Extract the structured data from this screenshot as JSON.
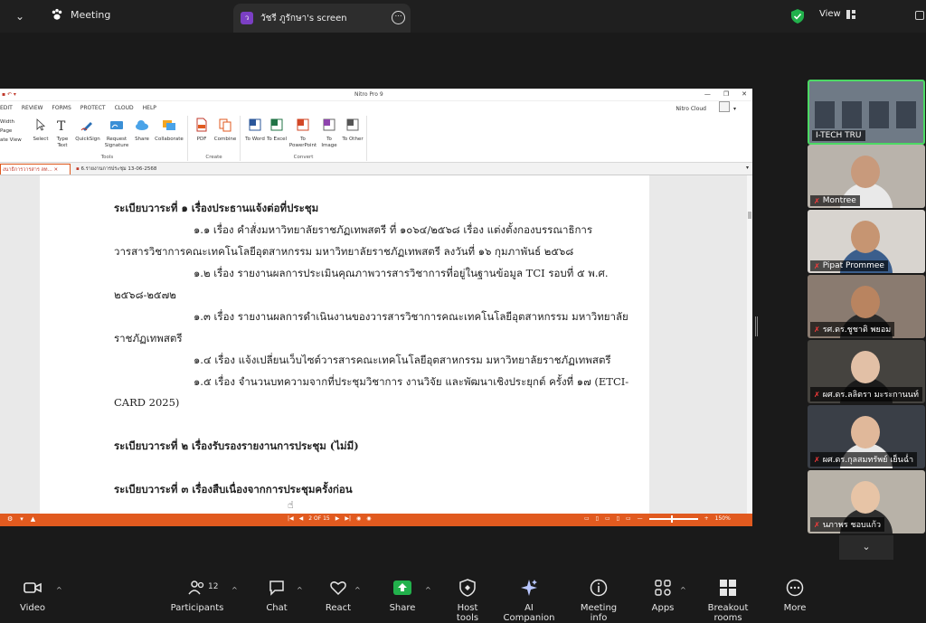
{
  "topbar": {
    "meeting_label": "Meeting",
    "share_tab_title": "วัชรี ภูรักษา's screen",
    "share_tab_avatar": "ว",
    "view_label": "View"
  },
  "nitro": {
    "app_title": "Nitro Pro 9",
    "menu": [
      "EDIT",
      "REVIEW",
      "FORMS",
      "PROTECT",
      "CLOUD",
      "HELP"
    ],
    "cloud_label": "Nitro Cloud",
    "left_tools": [
      "Width",
      "Page",
      "ate View"
    ],
    "tools_group": {
      "label": "Tools",
      "buttons": [
        "Select",
        "Type Text",
        "QuickSign",
        "Request Signature",
        "Share",
        "Collaborate"
      ]
    },
    "create_group": {
      "label": "Create",
      "buttons": [
        "PDF",
        "Combine"
      ]
    },
    "convert_group": {
      "label": "Convert",
      "buttons": [
        "To Word",
        "To Excel",
        "To PowerPoint",
        "To Image",
        "To Other"
      ]
    },
    "doc_tabs": [
      "งนาธิการวารสาร ลท...",
      "6.รายงานการประชุม 13-06-2568"
    ],
    "document_lines": [
      {
        "text": "ระเบียบวาระที่ ๑  เรื่องประธานแจ้งต่อที่ประชุม",
        "bold": true
      },
      {
        "text": "๑.๑ เรื่อง คำสั่งมหาวิทยาลัยราชภัฏเทพสตรี ที่ ๑๐๖๔/๒๕๖๘ เรื่อง แต่งตั้งกองบรรณาธิการ",
        "bold": false
      },
      {
        "text": "วารสารวิชาการคณะเทคโนโลยีอุตสาหกรรม มหาวิทยาลัยราชภัฏเทพสตรี ลงวันที่ ๑๖ กุมภาพันธ์ ๒๕๖๘",
        "bold": false
      },
      {
        "text": "๑.๒ เรื่อง รายงานผลการประเมินคุณภาพวารสารวิชาการที่อยู่ในฐานข้อมูล TCI รอบที่ ๕ พ.ศ.",
        "bold": false
      },
      {
        "text": "๒๕๖๘-๒๕๗๒",
        "bold": false
      },
      {
        "text": "๑.๓ เรื่อง รายงานผลการดำเนินงานของวารสารวิชาการคณะเทคโนโลยีอุตสาหกรรม มหาวิทยาลัย",
        "bold": false
      },
      {
        "text": "ราชภัฏเทพสตรี",
        "bold": false
      },
      {
        "text": "๑.๔ เรื่อง แจ้งเปลี่ยนเว็บไซต์วารสารคณะเทคโนโลยีอุตสาหกรรม มหาวิทยาลัยราชภัฏเทพสตรี",
        "bold": false
      },
      {
        "text": "๑.๕ เรื่อง จำนวนบทความจากที่ประชุมวิชาการ งานวิจัย และพัฒนาเชิงประยุกต์ ครั้งที่ ๑๗ (ETCI-",
        "bold": false
      },
      {
        "text": "CARD 2025)",
        "bold": false
      },
      {
        "text": "ระเบียบวาระที่ ๒  เรื่องรับรองรายงานการประชุม (ไม่มี)",
        "bold": true
      },
      {
        "text": "ระเบียบวาระที่ ๓  เรื่องสืบเนื่องจากการประชุมครั้งก่อน",
        "bold": true
      }
    ],
    "page_indicator": "2 OF 15",
    "zoom": "150%"
  },
  "participants": [
    {
      "name": "I-TECH TRU",
      "muted": false,
      "active": true
    },
    {
      "name": "Montree",
      "muted": true,
      "active": false
    },
    {
      "name": "Pipat Prommee",
      "muted": true,
      "active": false
    },
    {
      "name": "รศ.ดร.ชูชาติ  พยอม",
      "muted": true,
      "active": false
    },
    {
      "name": "ผศ.ดร.ลลิตรา มะระกานนท์",
      "muted": true,
      "active": false
    },
    {
      "name": "ผศ.ดร.กุลสมทรัพย์ เย็นฉ่ำ",
      "muted": true,
      "active": false
    },
    {
      "name": "นภาพร ชอบแก้ว",
      "muted": true,
      "active": false
    }
  ],
  "toolbar": {
    "video": "Video",
    "participants": "Participants",
    "participants_count": "12",
    "chat": "Chat",
    "react": "React",
    "share": "Share",
    "host_tools": "Host tools",
    "ai_companion": "AI Companion",
    "meeting_info": "Meeting info",
    "apps": "Apps",
    "breakout_rooms": "Breakout rooms",
    "more": "More"
  },
  "colors": {
    "zoom_bg": "#1a1a1a",
    "nitro_orange": "#e15a1f",
    "share_green": "#22b14c",
    "active_speaker": "#4cd964",
    "muted_red": "#ff3b3b"
  }
}
